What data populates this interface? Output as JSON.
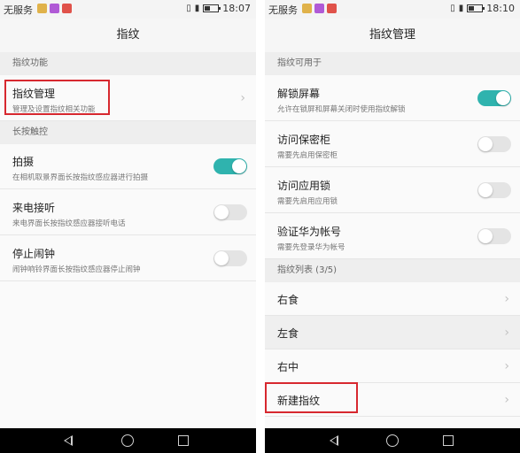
{
  "left": {
    "status": {
      "carrier": "无服务",
      "time": "18:07"
    },
    "title": "指纹",
    "sections": [
      {
        "header": "指纹功能"
      },
      {
        "header": "长按触控"
      }
    ],
    "fingerprint_manage": {
      "title": "指纹管理",
      "sub": "管理及设置指纹相关功能"
    },
    "toggles": [
      {
        "title": "拍摄",
        "sub": "在相机取景界面长按指纹感应器进行拍摄",
        "on": true
      },
      {
        "title": "来电接听",
        "sub": "来电界面长按指纹感应器接听电话",
        "on": false
      },
      {
        "title": "停止闹钟",
        "sub": "闹钟响铃界面长按指纹感应器停止闹钟",
        "on": false
      }
    ]
  },
  "right": {
    "status": {
      "carrier": "无服务",
      "time": "18:10"
    },
    "title": "指纹管理",
    "section_usable": "指纹可用于",
    "toggles": [
      {
        "title": "解锁屏幕",
        "sub": "允许在锁屏和屏幕关闭时使用指纹解锁",
        "on": true
      },
      {
        "title": "访问保密柜",
        "sub": "需要先启用保密柜",
        "on": false
      },
      {
        "title": "访问应用锁",
        "sub": "需要先启用应用锁",
        "on": false
      },
      {
        "title": "验证华为帐号",
        "sub": "需要先登录华为帐号",
        "on": false
      }
    ],
    "section_list": "指纹列表 (3/5)",
    "fingerprints": [
      "右食",
      "左食",
      "右中"
    ],
    "new_fingerprint": "新建指纹"
  },
  "colors": {
    "accent": "#2fb3ae",
    "highlight": "#d7282f"
  },
  "icons": {
    "status_apps": [
      "image-icon",
      "app-icon",
      "app-icon"
    ],
    "nav": [
      "back-icon",
      "home-icon",
      "recents-icon"
    ]
  }
}
